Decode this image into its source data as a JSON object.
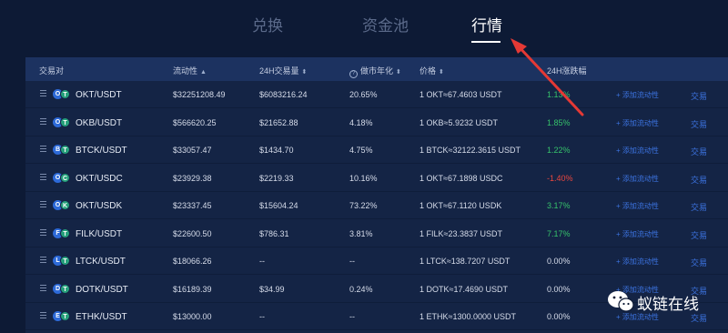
{
  "tabs": [
    {
      "label": "兑换",
      "active": false
    },
    {
      "label": "资金池",
      "active": false
    },
    {
      "label": "行情",
      "active": true
    }
  ],
  "table": {
    "headers": {
      "pair": "交易对",
      "liquidity": "流动性",
      "volume": "24H交易量",
      "apr": "做市年化",
      "price": "价格",
      "change": "24H涨跌幅"
    },
    "actions": {
      "add": "+ 添加流动性",
      "trade": "交易"
    },
    "rows": [
      {
        "pair": "OKT/USDT",
        "coin_a": "O",
        "coin_b": "T",
        "liquidity": "$32251208.49",
        "volume": "$6083216.24",
        "apr": "20.65%",
        "price": "1 OKT≈67.4603 USDT",
        "change": "1.13%",
        "trend": "up"
      },
      {
        "pair": "OKB/USDT",
        "coin_a": "O",
        "coin_b": "T",
        "liquidity": "$566620.25",
        "volume": "$21652.88",
        "apr": "4.18%",
        "price": "1 OKB≈5.9232 USDT",
        "change": "1.85%",
        "trend": "up"
      },
      {
        "pair": "BTCK/USDT",
        "coin_a": "B",
        "coin_b": "T",
        "liquidity": "$33057.47",
        "volume": "$1434.70",
        "apr": "4.75%",
        "price": "1 BTCK≈32122.3615 USDT",
        "change": "1.22%",
        "trend": "up"
      },
      {
        "pair": "OKT/USDC",
        "coin_a": "O",
        "coin_b": "C",
        "liquidity": "$23929.38",
        "volume": "$2219.33",
        "apr": "10.16%",
        "price": "1 OKT≈67.1898 USDC",
        "change": "-1.40%",
        "trend": "down"
      },
      {
        "pair": "OKT/USDK",
        "coin_a": "O",
        "coin_b": "K",
        "liquidity": "$23337.45",
        "volume": "$15604.24",
        "apr": "73.22%",
        "price": "1 OKT≈67.1120 USDK",
        "change": "3.17%",
        "trend": "up"
      },
      {
        "pair": "FILK/USDT",
        "coin_a": "F",
        "coin_b": "T",
        "liquidity": "$22600.50",
        "volume": "$786.31",
        "apr": "3.81%",
        "price": "1 FILK≈23.3837 USDT",
        "change": "7.17%",
        "trend": "up"
      },
      {
        "pair": "LTCK/USDT",
        "coin_a": "L",
        "coin_b": "T",
        "liquidity": "$18066.26",
        "volume": "--",
        "apr": "--",
        "price": "1 LTCK≈138.7207 USDT",
        "change": "0.00%",
        "trend": "flat"
      },
      {
        "pair": "DOTK/USDT",
        "coin_a": "D",
        "coin_b": "T",
        "liquidity": "$16189.39",
        "volume": "$34.99",
        "apr": "0.24%",
        "price": "1 DOTK≈17.4690 USDT",
        "change": "0.00%",
        "trend": "flat"
      },
      {
        "pair": "ETHK/USDT",
        "coin_a": "E",
        "coin_b": "T",
        "liquidity": "$13000.00",
        "volume": "--",
        "apr": "--",
        "price": "1 ETHK≈1300.0000 USDT",
        "change": "0.00%",
        "trend": "flat"
      }
    ]
  },
  "watermark": {
    "text": "蚁链在线"
  },
  "colors": {
    "background": "#0d1a35",
    "up": "#36c26b",
    "down": "#e9473f",
    "link": "#3c73e0",
    "arrow": "#e53935"
  }
}
